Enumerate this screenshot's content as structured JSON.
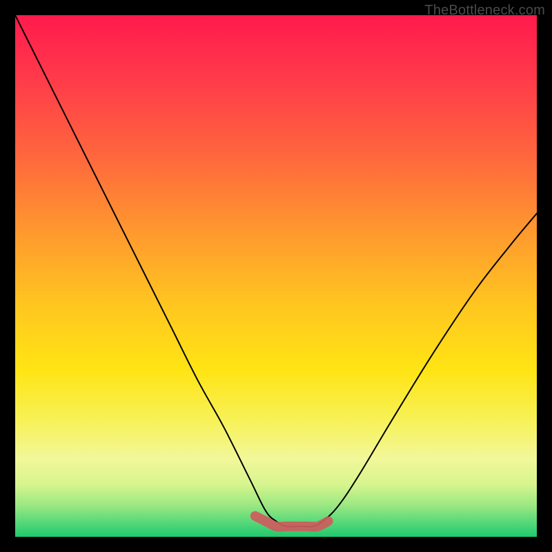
{
  "watermark": "TheBottleneck.com",
  "chart_data": {
    "type": "line",
    "title": "",
    "xlabel": "",
    "ylabel": "",
    "xlim": [
      0,
      100
    ],
    "ylim": [
      0,
      100
    ],
    "series": [
      {
        "name": "bottleneck-curve",
        "x": [
          0,
          5,
          10,
          15,
          20,
          25,
          30,
          35,
          40,
          45,
          48,
          50,
          52,
          55,
          57,
          59,
          62,
          66,
          72,
          80,
          88,
          95,
          100
        ],
        "values": [
          100,
          90,
          80,
          70,
          60,
          50,
          40,
          30,
          21,
          11,
          5,
          3,
          2,
          2,
          2,
          3,
          6,
          12,
          22,
          35,
          47,
          56,
          62
        ]
      },
      {
        "name": "bottom-marker",
        "x": [
          46,
          48,
          50,
          52,
          54,
          56,
          58,
          60
        ],
        "values": [
          4,
          3,
          2,
          2,
          2,
          2,
          2,
          3
        ]
      }
    ],
    "colors": {
      "curve": "#000000",
      "marker": "#cd5c5c",
      "gradient_top": "#ff1a4d",
      "gradient_bottom": "#1fc96f"
    }
  }
}
